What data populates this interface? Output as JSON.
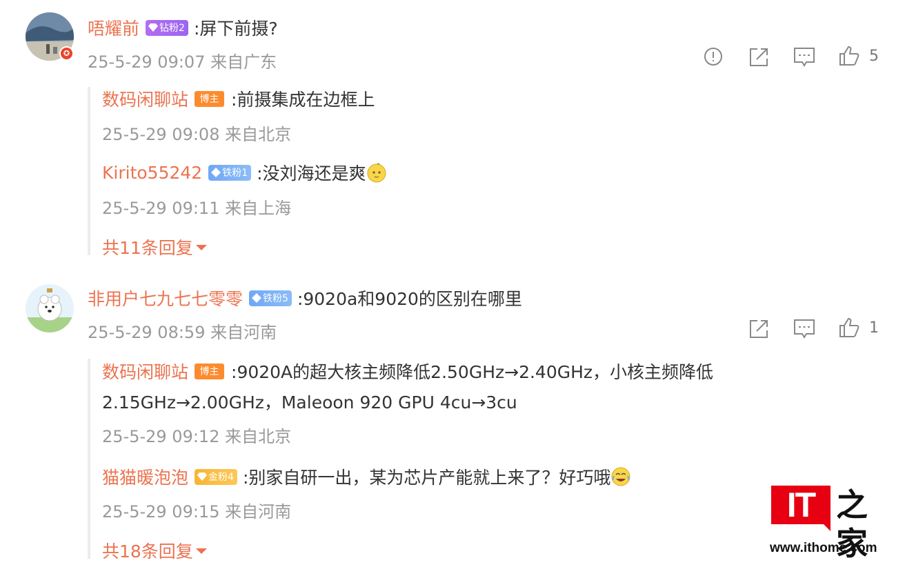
{
  "comments": [
    {
      "user": "唔耀前",
      "fan_badge": "钻粉2",
      "text": ":屏下前摄?",
      "meta": "25-5-29 09:07 来自广东",
      "likes": "5",
      "replies": [
        {
          "user": "数码闲聊站",
          "badge": "博主",
          "text": ":前摄集成在边框上",
          "meta": "25-5-29 09:08 来自北京"
        },
        {
          "user": "Kirito55242",
          "badge": "铁粉1",
          "text": ":没刘海还是爽",
          "meta": "25-5-29 09:11 来自上海"
        }
      ],
      "more_replies": "共11条回复"
    },
    {
      "user": "非用户七九七七零零",
      "fan_badge": "铁粉5",
      "text": ":9020a和9020的区别在哪里",
      "meta": "25-5-29 08:59 来自河南",
      "likes": "1",
      "replies": [
        {
          "user": "数码闲聊站",
          "badge": "博主",
          "text_line1": ":9020A的超大核主频降低2.50GHz→2.40GHz，小核主频降低",
          "text_line2": "2.15GHz→2.00GHz，Maleoon 920 GPU 4cu→3cu",
          "meta": "25-5-29 09:12 来自北京"
        },
        {
          "user": "猫猫暖泡泡",
          "badge": "金粉4",
          "text": ":别家自研一出，某为芯片产能就上来了？好巧哦",
          "meta": "25-5-29 09:15 来自河南"
        }
      ],
      "more_replies": "共18条回复"
    }
  ],
  "watermark": {
    "brand": "IT",
    "brand_cn": "之家",
    "url": "www.ithome.com"
  },
  "colors": {
    "username": "#eb7350",
    "meta": "#999999",
    "accent_red": "#e60012"
  },
  "icons": [
    "report-icon",
    "share-icon",
    "comment-icon",
    "like-icon",
    "diamond-icon",
    "verified-icon",
    "chevron-down-icon"
  ]
}
